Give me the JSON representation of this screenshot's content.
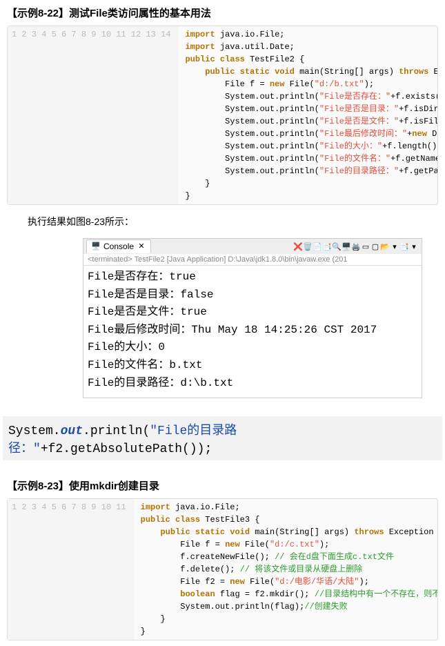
{
  "example1": {
    "title": "【示例8-22】测试File类访问属性的基本用法",
    "code": {
      "line_numbers": [
        "1",
        "2",
        "3",
        "4",
        "5",
        "6",
        "7",
        "8",
        "9",
        "10",
        "11",
        "12",
        "13",
        "14"
      ],
      "lines": [
        [
          {
            "t": "import",
            "c": "kw"
          },
          {
            "t": " java.io.File;"
          }
        ],
        [
          {
            "t": "import",
            "c": "kw"
          },
          {
            "t": " java.util.Date;"
          }
        ],
        [
          {
            "t": "public class",
            "c": "kw"
          },
          {
            "t": " TestFile2 {"
          }
        ],
        [
          {
            "t": "    "
          },
          {
            "t": "public static void",
            "c": "kw"
          },
          {
            "t": " main(String[] args) "
          },
          {
            "t": "throws",
            "c": "kw"
          },
          {
            "t": " Exception {"
          }
        ],
        [
          {
            "t": "        File f = "
          },
          {
            "t": "new",
            "c": "kw"
          },
          {
            "t": " File("
          },
          {
            "t": "\"d:/b.txt\"",
            "c": "str"
          },
          {
            "t": ");"
          }
        ],
        [
          {
            "t": "        System.out.println("
          },
          {
            "t": "\"File是否存在：\"",
            "c": "str"
          },
          {
            "t": "+f.exists());"
          }
        ],
        [
          {
            "t": "        System.out.println("
          },
          {
            "t": "\"File是否是目录：\"",
            "c": "str"
          },
          {
            "t": "+f.isDirectory());"
          }
        ],
        [
          {
            "t": "        System.out.println("
          },
          {
            "t": "\"File是否是文件：\"",
            "c": "str"
          },
          {
            "t": "+f.isFile());"
          }
        ],
        [
          {
            "t": "        System.out.println("
          },
          {
            "t": "\"File最后修改时间：\"",
            "c": "str"
          },
          {
            "t": "+"
          },
          {
            "t": "new",
            "c": "kw"
          },
          {
            "t": " Date(f.lastModified()));"
          }
        ],
        [
          {
            "t": "        System.out.println("
          },
          {
            "t": "\"File的大小：\"",
            "c": "str"
          },
          {
            "t": "+f.length());"
          }
        ],
        [
          {
            "t": "        System.out.println("
          },
          {
            "t": "\"File的文件名：\"",
            "c": "str"
          },
          {
            "t": "+f.getName());"
          }
        ],
        [
          {
            "t": "        System.out.println("
          },
          {
            "t": "\"File的目录路径：\"",
            "c": "str"
          },
          {
            "t": "+f.getPath());"
          }
        ],
        [
          {
            "t": "    }"
          }
        ],
        [
          {
            "t": "}"
          }
        ]
      ]
    }
  },
  "caption1": "执行结果如图8-23所示：",
  "console": {
    "tab_label": "Console",
    "subheader": "<terminated> TestFile2 [Java Application] D:\\Java\\jdk1.8.0\\bin\\javaw.exe (201",
    "output_lines": [
      "File是否存在：true",
      "File是否是目录：false",
      "File是否是文件：true",
      "File最后修改时间：Thu May 18 14:25:26 CST 2017",
      "File的大小：0",
      "File的文件名：b.txt",
      "File的目录路径：d:\\b.txt"
    ],
    "icons": [
      "❌",
      "🗑️",
      "📄",
      "📑",
      "🔍",
      "🖥️",
      "🖨️",
      "▭",
      "▢",
      "📂",
      "▾",
      "📑",
      "▾"
    ]
  },
  "highlight": {
    "prefix": "System.",
    "out": "out",
    "mid": ".println(",
    "quoted": "\"File的目录路径：\"",
    "suffix": "+f2.getAbsolutePath());"
  },
  "example2": {
    "title": "【示例8-23】使用mkdir创建目录",
    "code": {
      "line_numbers": [
        "1",
        "2",
        "3",
        "4",
        "5",
        "6",
        "7",
        "8",
        "9",
        "10",
        "11"
      ],
      "lines": [
        [
          {
            "t": "import",
            "c": "kw"
          },
          {
            "t": " java.io.File;"
          }
        ],
        [
          {
            "t": "public class",
            "c": "kw"
          },
          {
            "t": " TestFile3 {"
          }
        ],
        [
          {
            "t": "    "
          },
          {
            "t": "public static void",
            "c": "kw"
          },
          {
            "t": " main(String[] args) "
          },
          {
            "t": "throws",
            "c": "kw"
          },
          {
            "t": " Exception {"
          }
        ],
        [
          {
            "t": "        File f = "
          },
          {
            "t": "new",
            "c": "kw"
          },
          {
            "t": " File("
          },
          {
            "t": "\"d:/c.txt\"",
            "c": "str"
          },
          {
            "t": ");"
          }
        ],
        [
          {
            "t": "        f.createNewFile(); "
          },
          {
            "t": "// 会在d盘下面生成c.txt文件",
            "c": "cmt"
          }
        ],
        [
          {
            "t": "        f.delete(); "
          },
          {
            "t": "// 将该文件或目录从硬盘上删除",
            "c": "cmt"
          }
        ],
        [
          {
            "t": "        File f2 = "
          },
          {
            "t": "new",
            "c": "kw"
          },
          {
            "t": " File("
          },
          {
            "t": "\"d:/电影/华语/大陆\"",
            "c": "str"
          },
          {
            "t": ");"
          }
        ],
        [
          {
            "t": "        "
          },
          {
            "t": "boolean",
            "c": "kw"
          },
          {
            "t": " flag = f2.mkdir(); "
          },
          {
            "t": "//目录结构中有一个不存在，则不会创建整个目录树",
            "c": "cmt"
          }
        ],
        [
          {
            "t": "        System.out.println(flag);"
          },
          {
            "t": "//创建失败",
            "c": "cmt"
          }
        ],
        [
          {
            "t": "    }"
          }
        ],
        [
          {
            "t": "}"
          }
        ]
      ]
    }
  }
}
